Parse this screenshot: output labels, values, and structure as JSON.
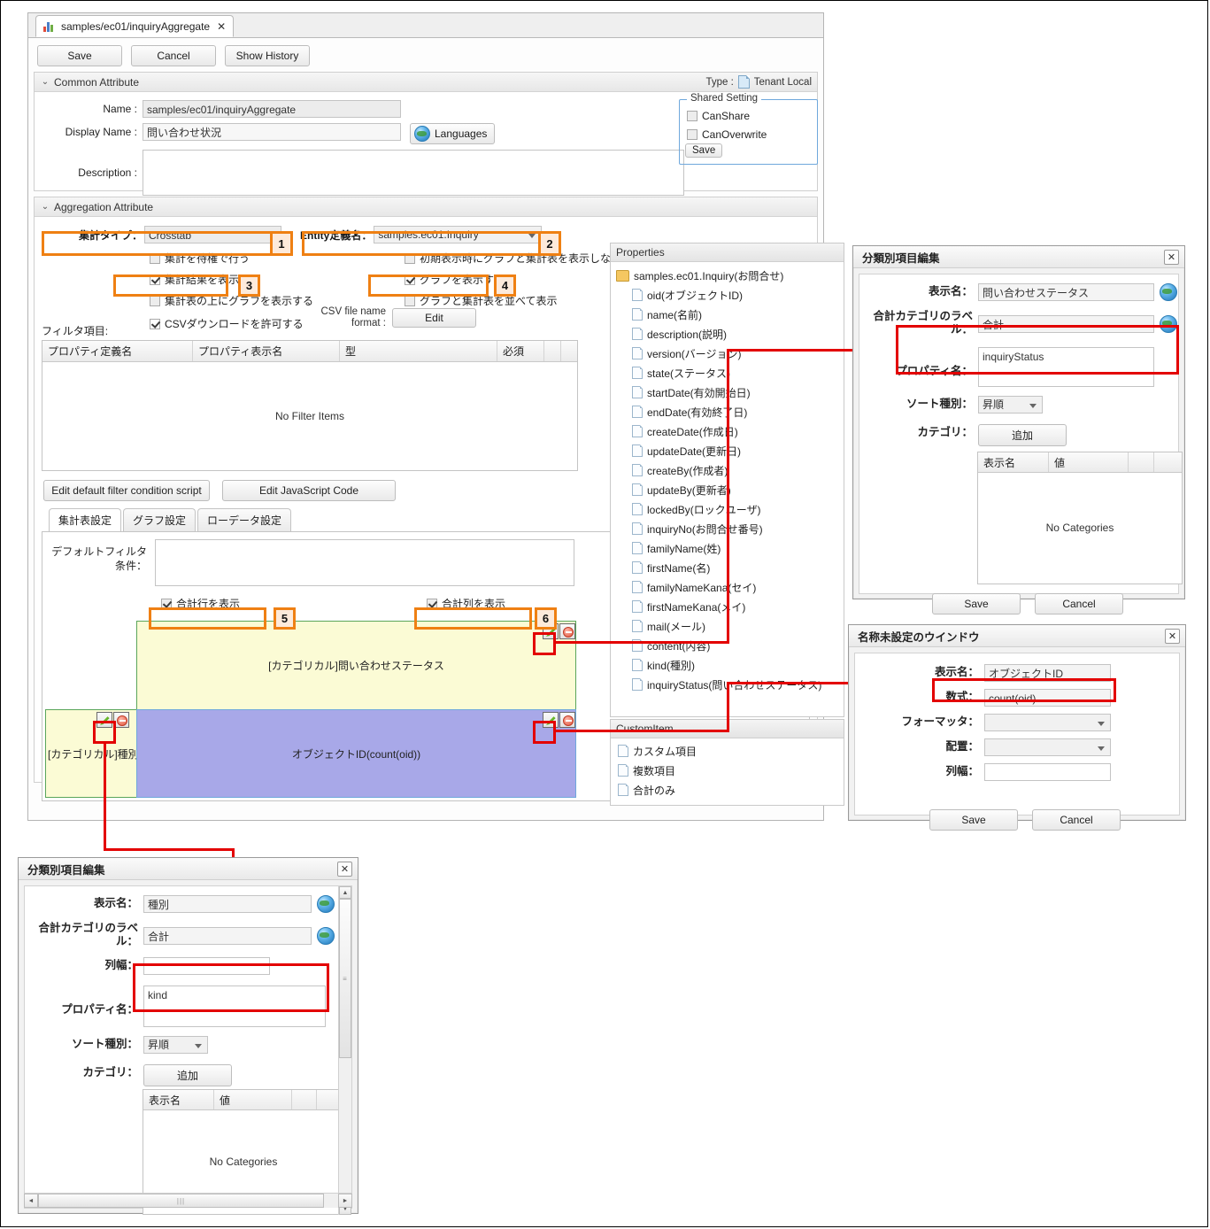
{
  "window": {
    "tab_label": "samples/ec01/inquiryAggregate",
    "tab_close": "✕",
    "toolbar": {
      "save": "Save",
      "cancel": "Cancel",
      "show_history": "Show History"
    }
  },
  "common_attribute": {
    "section_title": "Common Attribute",
    "type_label": "Type :",
    "type_value": "Tenant Local",
    "name_label": "Name :",
    "name_value": "samples/ec01/inquiryAggregate",
    "display_name_label": "Display Name :",
    "display_name_value": "問い合わせ状況",
    "languages_button": "Languages",
    "description_label": "Description :",
    "description_value": "",
    "shared_setting": {
      "legend": "Shared Setting",
      "can_share": "CanShare",
      "can_overwrite": "CanOverwrite",
      "save": "Save"
    }
  },
  "aggregation_attribute": {
    "section_title": "Aggregation Attribute",
    "agg_type_label": "集計タイプ：",
    "agg_type_value": "Crosstab",
    "entity_label": "Entity定義名：",
    "entity_value": "samples.ec01.Inquiry",
    "checkboxes": [
      {
        "label": "集計を待権で行う",
        "checked": false
      },
      {
        "label": "集計結果を表示する",
        "checked": true
      },
      {
        "label": "集計表の上にグラフを表示する",
        "checked": false
      },
      {
        "label": "CSVダウンロードを許可する",
        "checked": true
      },
      {
        "label": "初期表示時にグラフと集計表を表示しない",
        "checked": false
      },
      {
        "label": "グラフを表示する",
        "checked": true
      },
      {
        "label": "グラフと集計表を並べて表示",
        "checked": false
      }
    ],
    "csv_label": "CSV file name format :",
    "csv_edit": "Edit"
  },
  "filter": {
    "title": "フィルタ項目:",
    "columns": [
      "プロパティ定義名",
      "プロパティ表示名",
      "型",
      "必須",
      "",
      ""
    ],
    "empty_text": "No Filter Items",
    "edit_filter_script": "Edit default filter condition script",
    "edit_js": "Edit JavaScript Code"
  },
  "subtabs": [
    {
      "label": "集計表設定",
      "active": true
    },
    {
      "label": "グラフ設定",
      "active": false
    },
    {
      "label": "ローデータ設定",
      "active": false
    }
  ],
  "crosstab": {
    "default_filter_label": "デフォルトフィルタ条件：",
    "default_filter_value": "",
    "total_row_label": "合計行を表示",
    "total_row_checked": true,
    "total_col_label": "合計列を表示",
    "total_col_checked": true,
    "column_block": "[カテゴリカル]問い合わせステータス",
    "row_block": "[カテゴリカル]種別",
    "value_block": "オブジェクトID(count(oid))",
    "colors": {
      "category": "#fbfbd5",
      "category_border": "#5aa55a",
      "value": "#a8a8e8",
      "value_border": "#6fa8dc"
    }
  },
  "properties_panel": {
    "header": "Properties",
    "root": "samples.ec01.Inquiry(お問合せ)",
    "items": [
      "oid(オブジェクトID)",
      "name(名前)",
      "description(説明)",
      "version(バージョン)",
      "state(ステータス)",
      "startDate(有効開始日)",
      "endDate(有効終了日)",
      "createDate(作成日)",
      "updateDate(更新日)",
      "createBy(作成者)",
      "updateBy(更新者)",
      "lockedBy(ロックユーザ)",
      "inquiryNo(お問合せ番号)",
      "familyName(姓)",
      "firstName(名)",
      "familyNameKana(セイ)",
      "firstNameKana(メイ)",
      "mail(メール)",
      "content(内容)",
      "kind(種別)",
      "inquiryStatus(問い合わせステータス)"
    ]
  },
  "custom_item_panel": {
    "header": "CustomItem",
    "items": [
      "カスタム項目",
      "複数項目",
      "合計のみ"
    ]
  },
  "dialog_status": {
    "title": "分類別項目編集",
    "close": "✕",
    "display_name_label": "表示名：",
    "display_name_value": "問い合わせステータス",
    "total_label_label": "合計カテゴリのラベル：",
    "total_label_value": "合計",
    "property_label": "プロパティ名：",
    "property_value": "inquiryStatus",
    "sort_label": "ソート種別：",
    "sort_value": "昇順",
    "category_label": "カテゴリ：",
    "add_button": "追加",
    "table_columns": [
      "表示名",
      "値",
      "",
      ""
    ],
    "empty_text": "No Categories",
    "save": "Save",
    "cancel": "Cancel"
  },
  "dialog_measure": {
    "title": "名称未設定のウインドウ",
    "close": "✕",
    "display_name_label": "表示名：",
    "display_name_value": "オブジェクトID",
    "formula_label": "数式：",
    "formula_value": "count(oid)",
    "formatter_label": "フォーマッタ：",
    "formatter_value": "",
    "align_label": "配置：",
    "align_value": "",
    "colwidth_label": "列幅：",
    "colwidth_value": "",
    "save": "Save",
    "cancel": "Cancel"
  },
  "dialog_kind": {
    "title": "分類別項目編集",
    "close": "✕",
    "display_name_label": "表示名：",
    "display_name_value": "種別",
    "total_label_label": "合計カテゴリのラベル：",
    "total_label_value": "合計",
    "colwidth_label": "列幅：",
    "colwidth_value": "",
    "property_label": "プロパティ名：",
    "property_value": "kind",
    "sort_label": "ソート種別：",
    "sort_value": "昇順",
    "category_label": "カテゴリ：",
    "add_button": "追加",
    "table_columns": [
      "表示名",
      "値",
      "",
      ""
    ],
    "empty_text": "No Categories",
    "scroll_h_glyph": "|||",
    "scroll_arrow_left": "◄",
    "scroll_arrow_right": "►",
    "scroll_arrow_up": "▲",
    "scroll_arrow_down": "▼",
    "scroll_v_glyph": "≡"
  },
  "callouts": [
    {
      "n": "1"
    },
    {
      "n": "2"
    },
    {
      "n": "3"
    },
    {
      "n": "4"
    },
    {
      "n": "5"
    },
    {
      "n": "6"
    }
  ],
  "accent": {
    "orange": "#ef8013",
    "red": "#e30000"
  }
}
